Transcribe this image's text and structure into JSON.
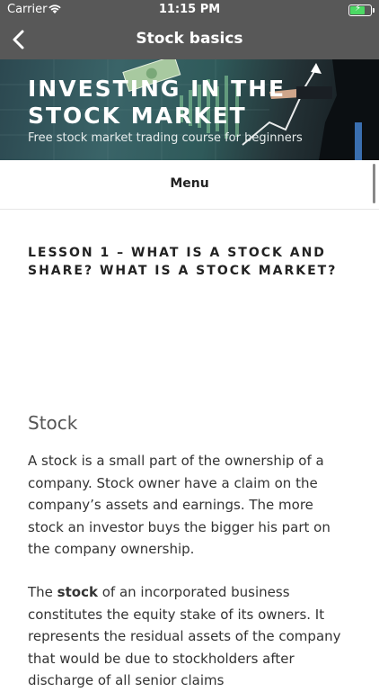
{
  "status_bar": {
    "carrier": "Carrier",
    "time": "11:15 PM",
    "icons": [
      "wifi-icon",
      "battery-charging-icon"
    ]
  },
  "nav": {
    "title": "Stock basics",
    "back_icon": "chevron-left-icon"
  },
  "hero": {
    "title": "INVESTING IN THE STOCK MARKET",
    "subtitle": "Free stock market trading course for beginners"
  },
  "menu": {
    "label": "Menu"
  },
  "article": {
    "lesson_title": "LESSON 1 – WHAT IS A STOCK AND SHARE? WHAT IS A STOCK MARKET?",
    "section_heading": "Stock",
    "paragraph1": "A stock is a small part of the ownership of a company. Stock owner have a claim on the company’s assets and earnings. The more stock an investor buys the bigger his part on the company ownership.",
    "paragraph2_prefix": "The ",
    "paragraph2_bold": "stock",
    "paragraph2_rest": " of an incorporated business constitutes the equity stake of its owners. It represents the residual assets of the company that would be due to stockholders after discharge of all senior claims"
  },
  "colors": {
    "bar_background": "#585858",
    "battery_fill": "#4cd964"
  }
}
